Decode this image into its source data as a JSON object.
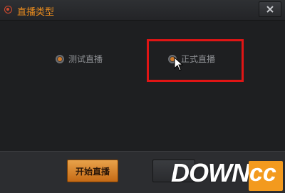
{
  "window": {
    "title": "直播类型",
    "close_glyph": "✕"
  },
  "options": [
    {
      "label": "测试直播",
      "selected": true
    },
    {
      "label": "正式直播",
      "selected": false
    }
  ],
  "footer": {
    "start_label": "开始直播",
    "cancel_label": ""
  },
  "watermark": {
    "text": "DOWN",
    "dot": ".",
    "suffix": "cc"
  },
  "colors": {
    "accent": "#e58a1f",
    "highlight": "#e01515",
    "button": "#d07a2a"
  }
}
